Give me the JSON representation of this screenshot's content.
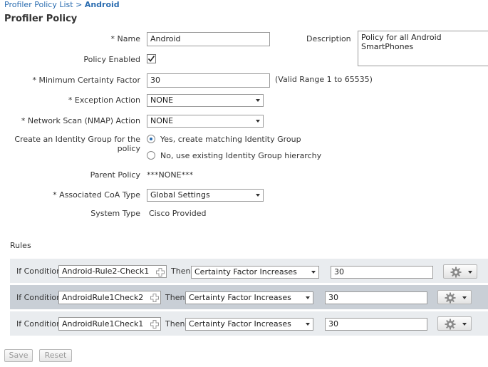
{
  "breadcrumb": {
    "parent": "Profiler Policy List",
    "sep": " > ",
    "current": "Android"
  },
  "page_title": "Profiler Policy",
  "form": {
    "name_label": "* Name",
    "name_value": "Android",
    "description_label": "Description",
    "description_value": "Policy for all Android SmartPhones",
    "policy_enabled_label": "Policy Enabled",
    "policy_enabled_checked": true,
    "min_cf_label": "* Minimum Certainty Factor",
    "min_cf_value": "30",
    "min_cf_hint": "(Valid Range 1 to 65535)",
    "exception_label": "* Exception Action",
    "exception_value": "NONE",
    "nmap_label": "* Network Scan (NMAP) Action",
    "nmap_value": "NONE",
    "identity_group_label": "Create an Identity Group for the policy",
    "identity_yes": "Yes, create matching Identity Group",
    "identity_no": "No, use existing Identity Group hierarchy",
    "parent_policy_label": "Parent Policy",
    "parent_policy_value": "***NONE***",
    "coa_label": "* Associated CoA Type",
    "coa_value": "Global Settings",
    "system_type_label": "System Type",
    "system_type_value": "Cisco Provided"
  },
  "rules": {
    "heading": "Rules",
    "if_label": "If Condition",
    "then_label": "Then",
    "rows": [
      {
        "condition": "Android-Rule2-Check1",
        "action": "Certainty Factor Increases",
        "value": "30"
      },
      {
        "condition": "AndroidRule1Check2",
        "action": "Certainty Factor Increases",
        "value": "30"
      },
      {
        "condition": "AndroidRule1Check1",
        "action": "Certainty Factor Increases",
        "value": "30"
      }
    ]
  },
  "buttons": {
    "save": "Save",
    "reset": "Reset"
  },
  "colors": {
    "link": "#2a6cb0",
    "selected_row": "#c9cfd6",
    "row_bg": "#e9ecef"
  }
}
